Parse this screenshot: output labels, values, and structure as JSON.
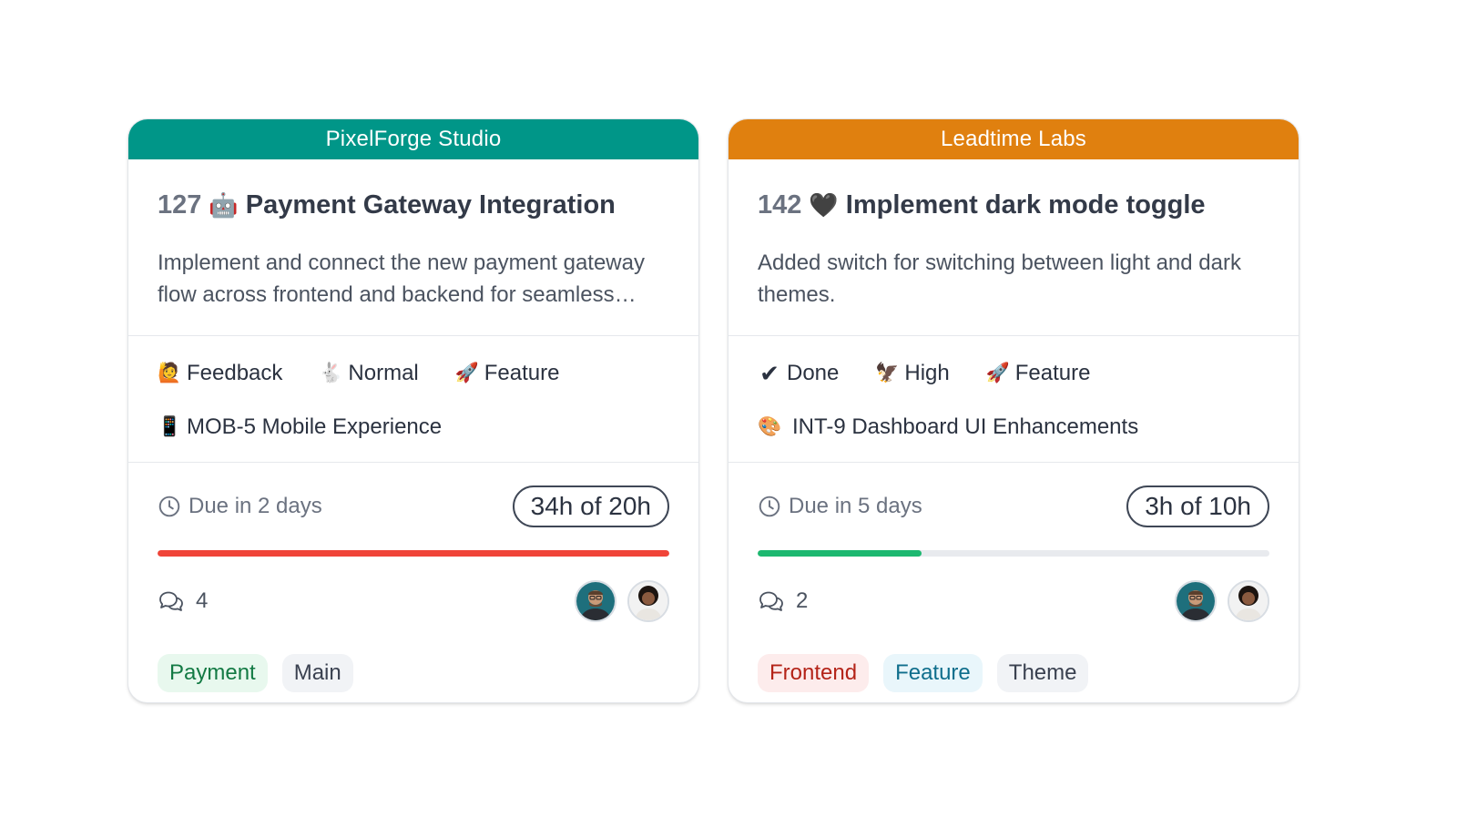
{
  "cards": [
    {
      "org": {
        "name": "PixelForge Studio",
        "color": "#009688"
      },
      "task": {
        "number": "127",
        "emoji": "🤖",
        "title": "Payment Gateway Integration",
        "description": "Implement and connect the new payment gateway flow across frontend and backend for seamless transactions."
      },
      "properties": {
        "status": {
          "icon": "🙋",
          "label": "Feedback"
        },
        "priority": {
          "icon": "🐇",
          "label": "Normal"
        },
        "type": {
          "icon": "🚀",
          "label": "Feature"
        },
        "project": {
          "icon": "📱",
          "label": "MOB-5 Mobile Experience"
        }
      },
      "due": {
        "icon": "clock-icon",
        "label": "Due in 2 days"
      },
      "hours": {
        "label": "34h of 20h",
        "logged": 34,
        "estimate": 20
      },
      "progress": {
        "fraction": 1.0,
        "color": "#f04438"
      },
      "comments": {
        "icon": "comments-icon",
        "count": "4"
      },
      "assignees": [
        "man-with-glasses-avatar",
        "woman-curly-hair-avatar"
      ],
      "tags": [
        {
          "label": "Payment",
          "bg": "#e8f8ee",
          "fg": "#137a44"
        },
        {
          "label": "Main",
          "bg": "#f1f3f6",
          "fg": "#3a4150"
        }
      ]
    },
    {
      "org": {
        "name": "Leadtime Labs",
        "color": "#e0800f"
      },
      "task": {
        "number": "142",
        "emoji": "🖤",
        "title": "Implement dark mode toggle",
        "description": "Added switch for switching between light and dark themes."
      },
      "properties": {
        "status": {
          "icon": "✔",
          "label": "Done"
        },
        "priority": {
          "icon": "🦅",
          "label": "High"
        },
        "type": {
          "icon": "🚀",
          "label": "Feature"
        },
        "project": {
          "icon": "🎨",
          "label": "INT-9 Dashboard UI Enhancements"
        }
      },
      "due": {
        "icon": "clock-icon",
        "label": "Due in 5 days"
      },
      "hours": {
        "label": "3h of 10h",
        "logged": 3,
        "estimate": 10
      },
      "progress": {
        "fraction": 0.32,
        "color": "#1db870"
      },
      "comments": {
        "icon": "comments-icon",
        "count": "2"
      },
      "assignees": [
        "man-with-glasses-avatar",
        "woman-curly-hair-avatar"
      ],
      "tags": [
        {
          "label": "Frontend",
          "bg": "#fdecec",
          "fg": "#b42318"
        },
        {
          "label": "Feature",
          "bg": "#e9f6fb",
          "fg": "#0f6e8c"
        },
        {
          "label": "Theme",
          "bg": "#f1f3f6",
          "fg": "#3a4150"
        }
      ]
    }
  ]
}
